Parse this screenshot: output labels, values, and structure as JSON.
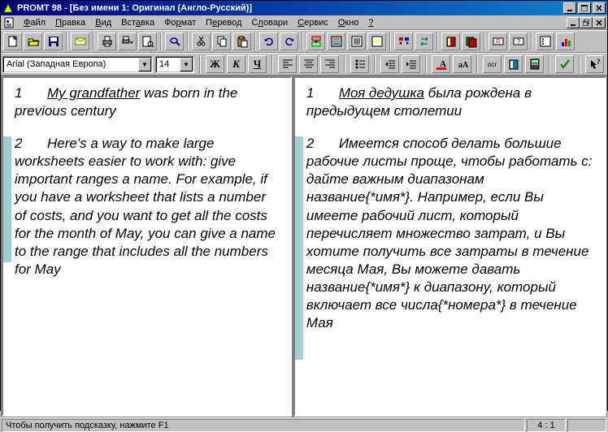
{
  "title": {
    "app": "PROMT 98 - ",
    "doc": "[Без имени 1: Оригинал (Англо-Русский)]"
  },
  "menu": {
    "items": [
      "Файл",
      "Правка",
      "Вид",
      "Вставка",
      "Формат",
      "Перевод",
      "Словари",
      "Сервис",
      "Окно",
      "?"
    ]
  },
  "format": {
    "font": "Arial (Западная Европа)",
    "size": "14",
    "bold": "Ж",
    "italic": "К",
    "underline": "Ч",
    "ocr": "ocr"
  },
  "panes": {
    "left": {
      "p1_num": "1",
      "p1_underlined": "My grandfather",
      "p1_rest": " was born in the previous century",
      "p2_num": "2",
      "p2_text": "Here's a way to make large worksheets easier to work with: give important ranges a name. For example, if you have a worksheet that lists a number of costs, and you want to get all the costs for the month of May, you can give a name to the range that includes all the numbers for May"
    },
    "right": {
      "p1_num": "1",
      "p1_underlined": "Моя дедушка",
      "p1_rest": " была рождена в предыдущем столетии",
      "p2_num": "2",
      "p2_text": "Имеется способ делать большие рабочие листы проще, чтобы работать с: дайте важным диапазонам название{*имя*}. Например, если Вы имеете рабочий лист, который перечисляет множество затрат, и Вы хотите получить все затраты в течение месяца Мая, Вы можете давать название{*имя*} к диапазону, который включает все числа{*номера*} в течение Мая"
    }
  },
  "status": {
    "hint": "Чтобы получить подсказку, нажмите F1",
    "pos": "4 : 1"
  }
}
